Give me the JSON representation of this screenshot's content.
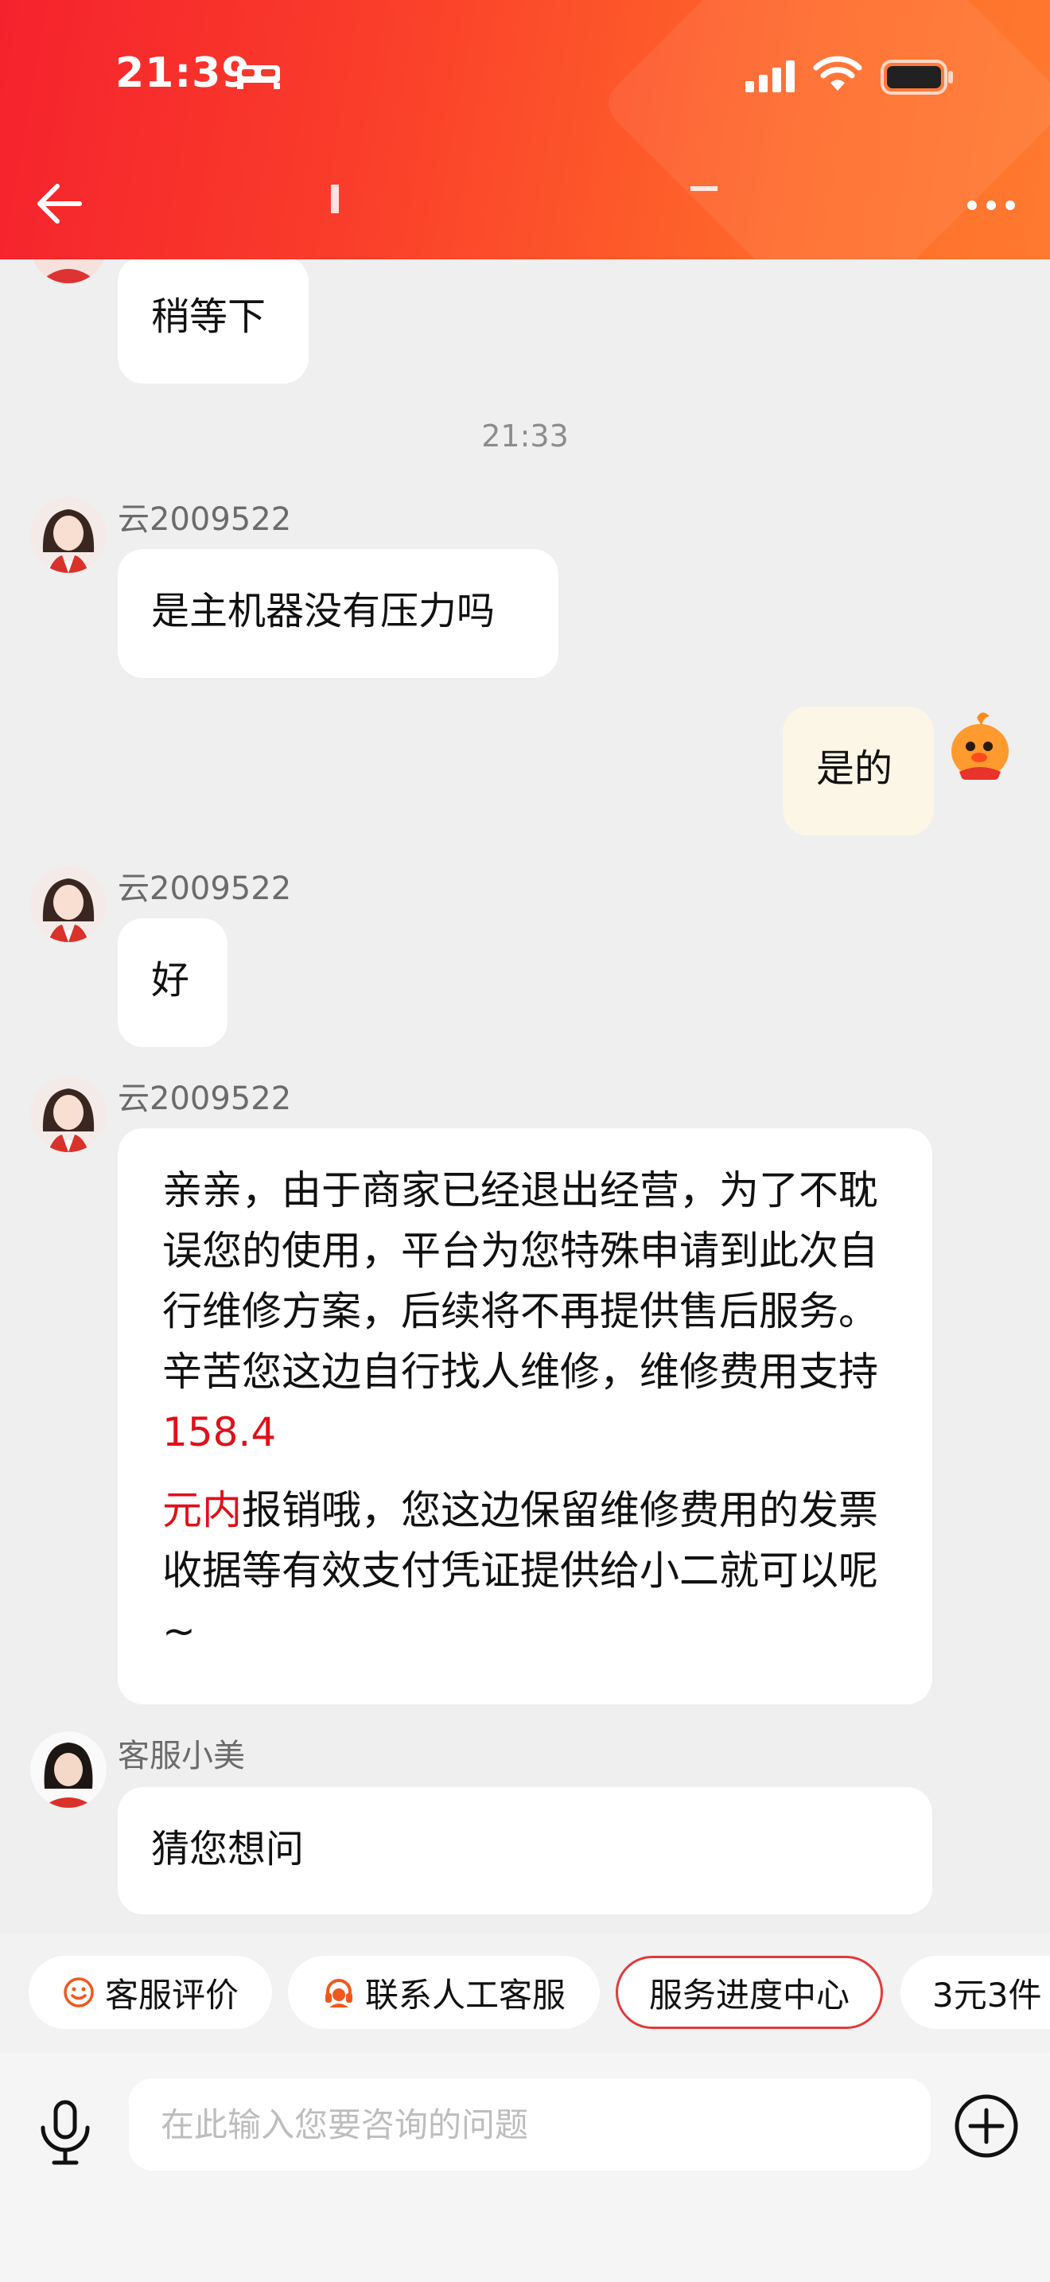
{
  "status_bar": {
    "time": "21:39"
  },
  "messages": [
    {
      "id": "m0",
      "from": "agent",
      "text": "稍等下"
    },
    {
      "id": "t1",
      "type": "time",
      "text": "21:33"
    },
    {
      "id": "m1",
      "from": "agent",
      "sender": "云2009522",
      "text": "是主机器没有压力吗"
    },
    {
      "id": "m2",
      "from": "me",
      "text": "是的"
    },
    {
      "id": "m3",
      "from": "agent",
      "sender": "云2009522",
      "text": "好"
    },
    {
      "id": "m4",
      "from": "agent",
      "sender": "云2009522",
      "p1": "亲亲，由于商家已经退出经营，为了不耽误您的使用，平台为您特殊申请到此次自行维修方案，后续将不再提供售后服务。辛苦您这边自行找人维修，维修费用支持",
      "p1_highlight": "158.4",
      "p2_highlight": "元内",
      "p2": "报销哦，您这边保留维修费用的发票收据等有效支付凭证提供给小二就可以呢~"
    },
    {
      "id": "m5",
      "from": "bot",
      "sender": "客服小美",
      "text": "猜您想问"
    }
  ],
  "quick_replies": [
    {
      "label": "客服评价",
      "icon": "smile-icon"
    },
    {
      "label": "联系人工客服",
      "icon": "headset-icon"
    },
    {
      "label": "服务进度中心",
      "icon": ""
    },
    {
      "label": "3元3件",
      "icon": ""
    }
  ],
  "input": {
    "placeholder": "在此输入您要咨询的问题"
  },
  "colors": {
    "header_start": "#f5222d",
    "header_end": "#ff7a30",
    "highlight": "#e0101a",
    "my_bubble": "#fbf6e6"
  }
}
